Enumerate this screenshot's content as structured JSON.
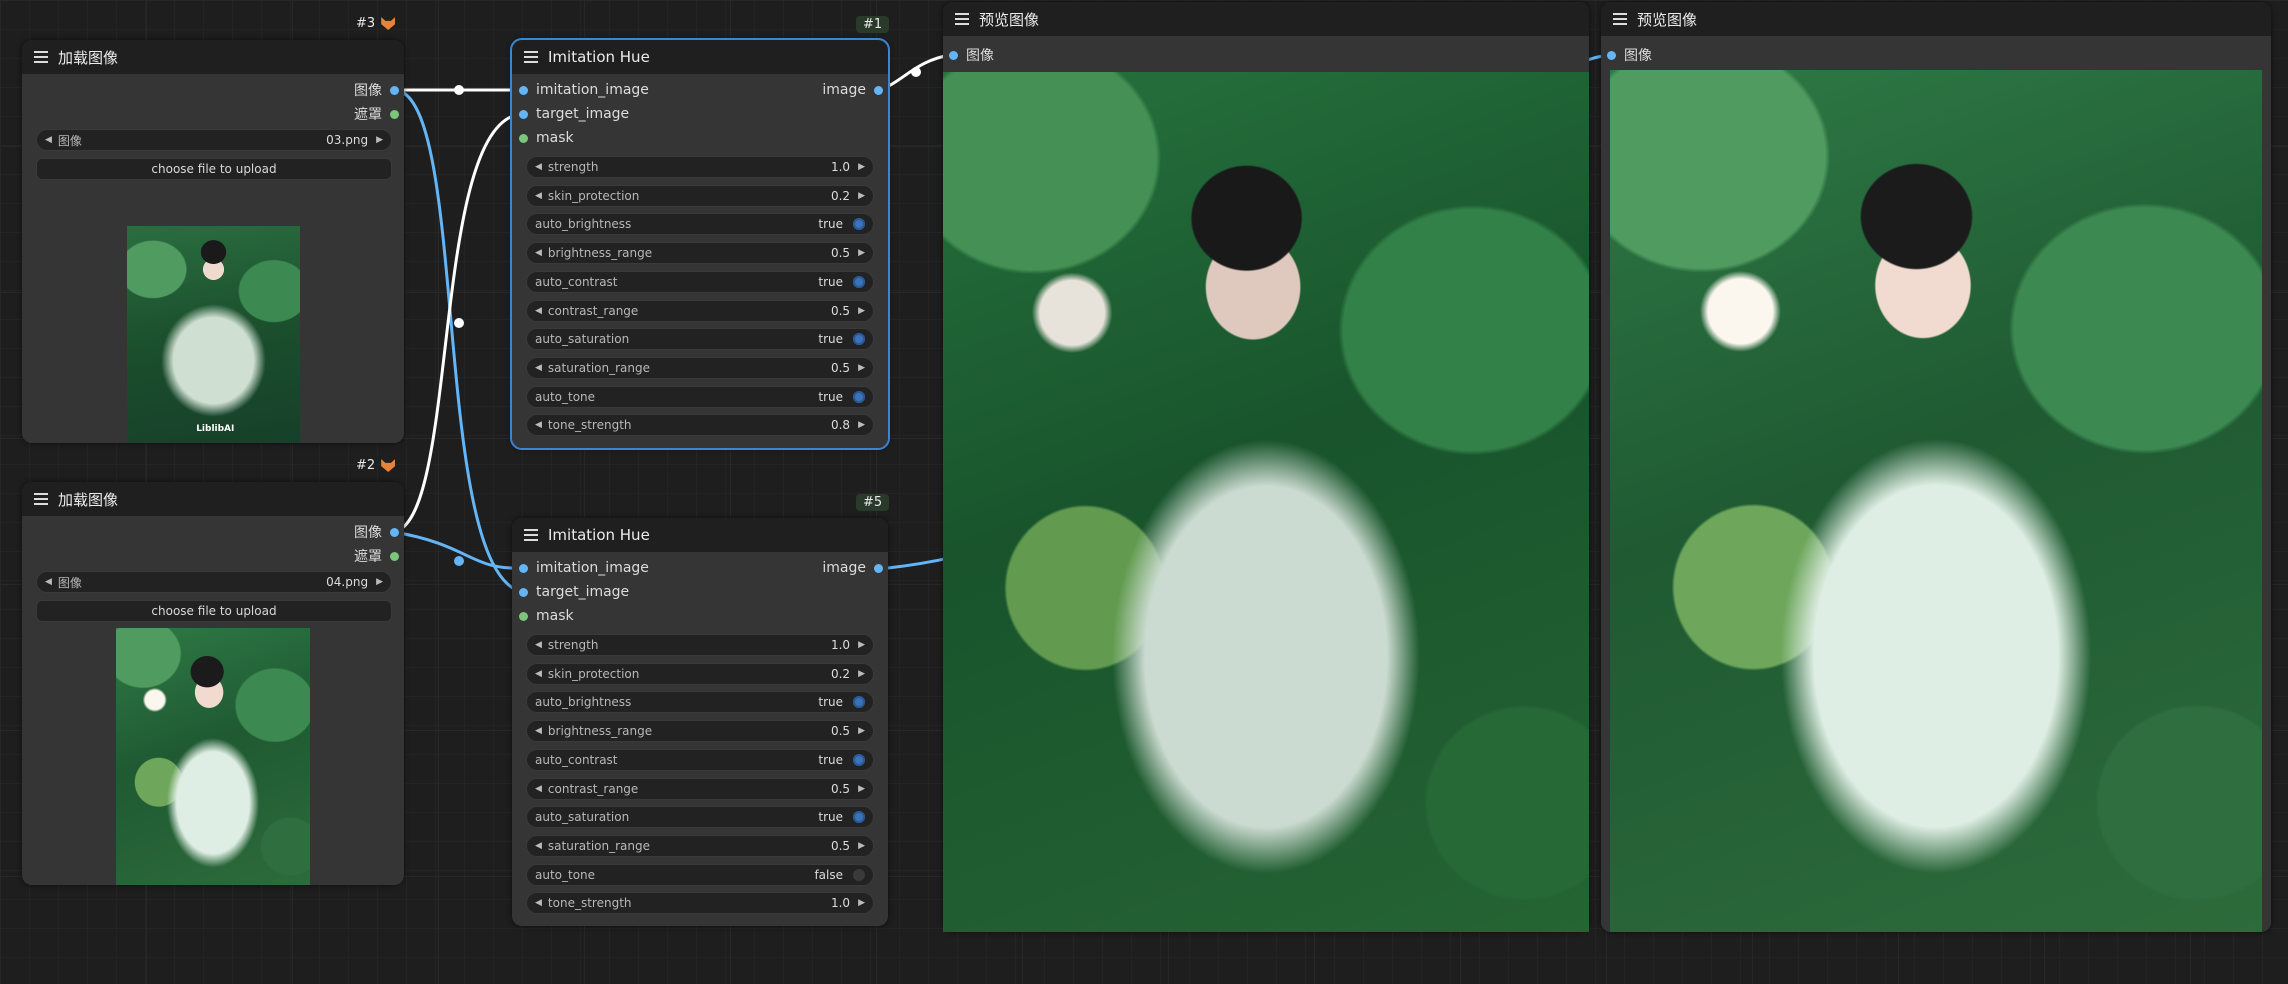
{
  "app": {
    "accent": "#3b86d4",
    "link_color": "#64b5f6",
    "mask_color": "#7bc67b"
  },
  "load_nodes": [
    {
      "id": "#3",
      "title": "加载图像",
      "outputs": [
        "图像",
        "遮罩"
      ],
      "file_label": "图像",
      "file_value": "03.png",
      "upload_label": "choose file to upload",
      "watermark": "LiblibAI"
    },
    {
      "id": "#2",
      "title": "加载图像",
      "outputs": [
        "图像",
        "遮罩"
      ],
      "file_label": "图像",
      "file_value": "04.png",
      "upload_label": "choose file to upload"
    }
  ],
  "hue_nodes": [
    {
      "id": "#1",
      "title": "Imitation Hue",
      "inputs": [
        "imitation_image",
        "target_image",
        "mask"
      ],
      "output": "image",
      "widgets": [
        {
          "label": "strength",
          "value": "1.0",
          "kind": "number"
        },
        {
          "label": "skin_protection",
          "value": "0.2",
          "kind": "number"
        },
        {
          "label": "auto_brightness",
          "value": "true",
          "kind": "toggle"
        },
        {
          "label": "brightness_range",
          "value": "0.5",
          "kind": "number"
        },
        {
          "label": "auto_contrast",
          "value": "true",
          "kind": "toggle"
        },
        {
          "label": "contrast_range",
          "value": "0.5",
          "kind": "number"
        },
        {
          "label": "auto_saturation",
          "value": "true",
          "kind": "toggle"
        },
        {
          "label": "saturation_range",
          "value": "0.5",
          "kind": "number"
        },
        {
          "label": "auto_tone",
          "value": "true",
          "kind": "toggle"
        },
        {
          "label": "tone_strength",
          "value": "0.8",
          "kind": "number"
        }
      ]
    },
    {
      "id": "#5",
      "title": "Imitation Hue",
      "inputs": [
        "imitation_image",
        "target_image",
        "mask"
      ],
      "output": "image",
      "widgets": [
        {
          "label": "strength",
          "value": "1.0",
          "kind": "number"
        },
        {
          "label": "skin_protection",
          "value": "0.2",
          "kind": "number"
        },
        {
          "label": "auto_brightness",
          "value": "true",
          "kind": "toggle"
        },
        {
          "label": "brightness_range",
          "value": "0.5",
          "kind": "number"
        },
        {
          "label": "auto_contrast",
          "value": "true",
          "kind": "toggle"
        },
        {
          "label": "contrast_range",
          "value": "0.5",
          "kind": "number"
        },
        {
          "label": "auto_saturation",
          "value": "true",
          "kind": "toggle"
        },
        {
          "label": "saturation_range",
          "value": "0.5",
          "kind": "number"
        },
        {
          "label": "auto_tone",
          "value": "false",
          "kind": "toggle"
        },
        {
          "label": "tone_strength",
          "value": "1.0",
          "kind": "number"
        }
      ]
    }
  ],
  "preview_nodes": [
    {
      "title": "预览图像",
      "input": "图像"
    },
    {
      "title": "预览图像",
      "input": "图像"
    }
  ]
}
